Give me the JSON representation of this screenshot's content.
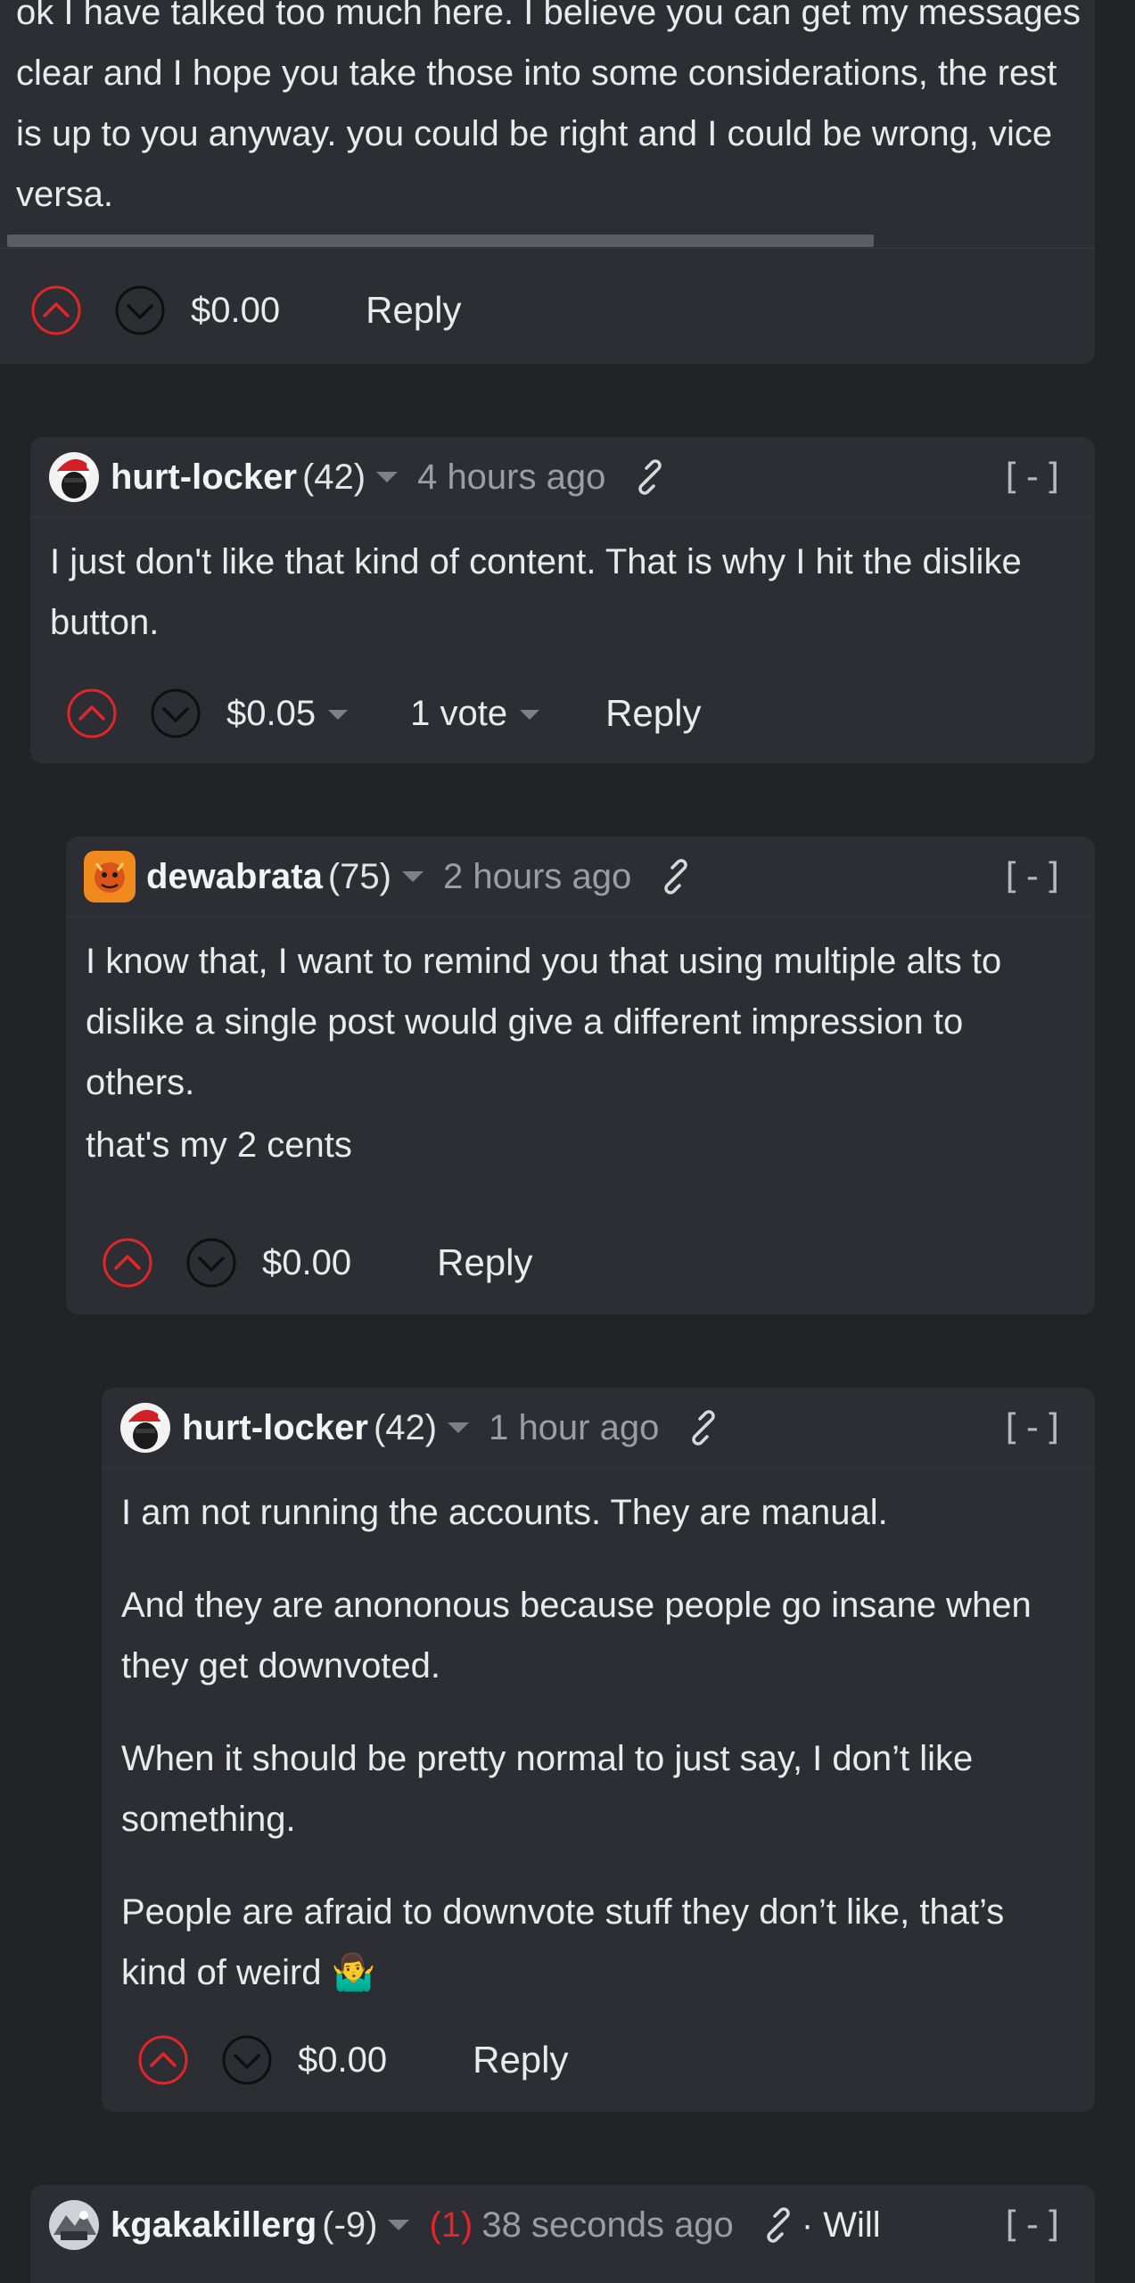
{
  "top_comment": {
    "paragraph": "ok I have talked too much here. I believe you can get my messages clear and I hope you take those into some considerations, the rest is up to you anyway. you could be right and I could be wrong, vice versa.",
    "payout": "$0.00",
    "reply_label": "Reply"
  },
  "comments": [
    {
      "author": "hurt-locker",
      "reputation": "(42)",
      "time": "4 hours ago",
      "collapse": "[-]",
      "paragraphs": [
        "I just don't like that kind of content. That is why I hit the dislike button."
      ],
      "payout": "$0.05",
      "votes": "1 vote",
      "reply_label": "Reply"
    },
    {
      "author": "dewabrata",
      "reputation": "(75)",
      "time": "2 hours ago",
      "collapse": "[-]",
      "paragraphs": [
        "I know that, I want to remind you that using multiple alts to dislike a single post would give a different impression to others.",
        "that's my 2 cents"
      ],
      "payout": "$0.00",
      "reply_label": "Reply"
    },
    {
      "author": "hurt-locker",
      "reputation": "(42)",
      "time": "1 hour ago",
      "collapse": "[-]",
      "paragraphs": [
        "I am not running the accounts. They are manual.",
        "And they are anononous because people go insane when they get downvoted.",
        "When it should be pretty normal to just say, I don’t like something.",
        "People are afraid to downvote stuff they don’t like, that’s kind of weird 🤷‍♂️"
      ],
      "payout": "$0.00",
      "reply_label": "Reply"
    },
    {
      "author": "kgakakillerg",
      "reputation": "(-9)",
      "new_count": "(1)",
      "time": "38 seconds ago",
      "extra": "· Will",
      "collapse": "[-]"
    }
  ],
  "colors": {
    "background": "#212327",
    "card": "#2c2e33",
    "upvote_red": "#e0262a",
    "muted_text": "#9a9da3"
  },
  "icons": {
    "upvote": "chevron-up-circle-icon",
    "downvote": "chevron-down-circle-icon",
    "permalink": "link-icon",
    "dropdown": "caret-down-icon"
  }
}
